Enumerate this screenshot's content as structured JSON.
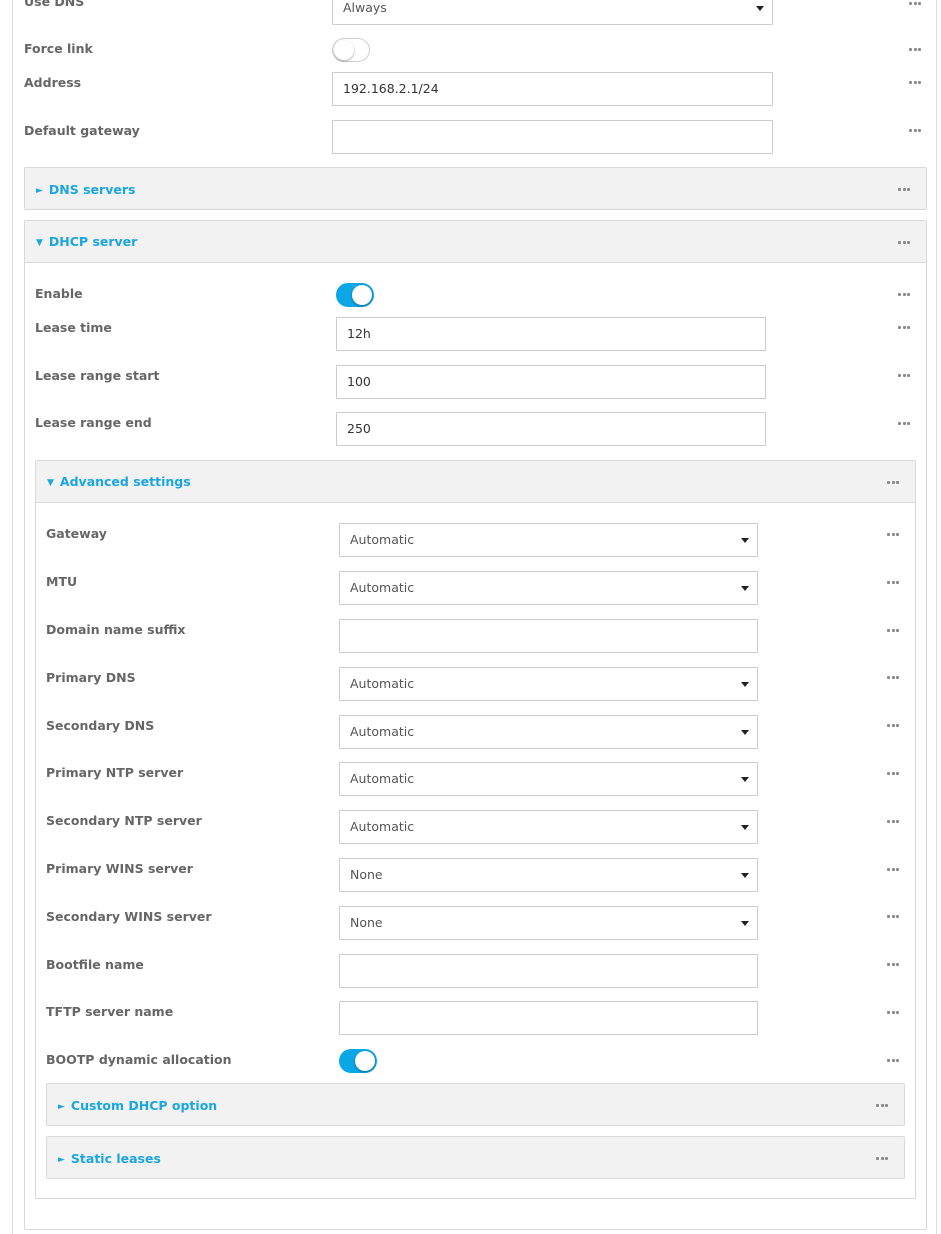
{
  "top_fields": {
    "use_dns": {
      "label": "Use DNS",
      "value": "Always"
    },
    "force_link": {
      "label": "Force link",
      "enabled": false
    },
    "address": {
      "label": "Address",
      "value": "192.168.2.1/24"
    },
    "default_gateway": {
      "label": "Default gateway",
      "value": ""
    }
  },
  "dns_servers": {
    "title": "DNS servers",
    "expanded": false
  },
  "dhcp_server": {
    "title": "DHCP server",
    "expanded": true,
    "enable": {
      "label": "Enable",
      "enabled": true
    },
    "lease_time": {
      "label": "Lease time",
      "value": "12h"
    },
    "lease_range_start": {
      "label": "Lease range start",
      "value": "100"
    },
    "lease_range_end": {
      "label": "Lease range end",
      "value": "250"
    },
    "advanced": {
      "title": "Advanced settings",
      "expanded": true,
      "gateway": {
        "label": "Gateway",
        "value": "Automatic"
      },
      "mtu": {
        "label": "MTU",
        "value": "Automatic"
      },
      "domain_name_suffix": {
        "label": "Domain name suffix",
        "value": ""
      },
      "primary_dns": {
        "label": "Primary DNS",
        "value": "Automatic"
      },
      "secondary_dns": {
        "label": "Secondary DNS",
        "value": "Automatic"
      },
      "primary_ntp": {
        "label": "Primary NTP server",
        "value": "Automatic"
      },
      "secondary_ntp": {
        "label": "Secondary NTP server",
        "value": "Automatic"
      },
      "primary_wins": {
        "label": "Primary WINS server",
        "value": "None"
      },
      "secondary_wins": {
        "label": "Secondary WINS server",
        "value": "None"
      },
      "bootfile_name": {
        "label": "Bootfile name",
        "value": ""
      },
      "tftp_server_name": {
        "label": "TFTP server name",
        "value": ""
      },
      "bootp": {
        "label": "BOOTP dynamic allocation",
        "enabled": true
      },
      "custom_dhcp_option": {
        "title": "Custom DHCP option",
        "expanded": false
      },
      "static_leases": {
        "title": "Static leases",
        "expanded": false
      }
    }
  },
  "icons": {
    "more": "more-options-icon",
    "collapsed": "triangle-right-icon",
    "expanded": "triangle-down-icon"
  },
  "colors": {
    "accent": "#1ba6e0",
    "toggle_on": "#0aa6e5",
    "header_bg": "#f2f2f2"
  },
  "glyphs": {
    "collapsed": "►",
    "expanded": "▼"
  }
}
